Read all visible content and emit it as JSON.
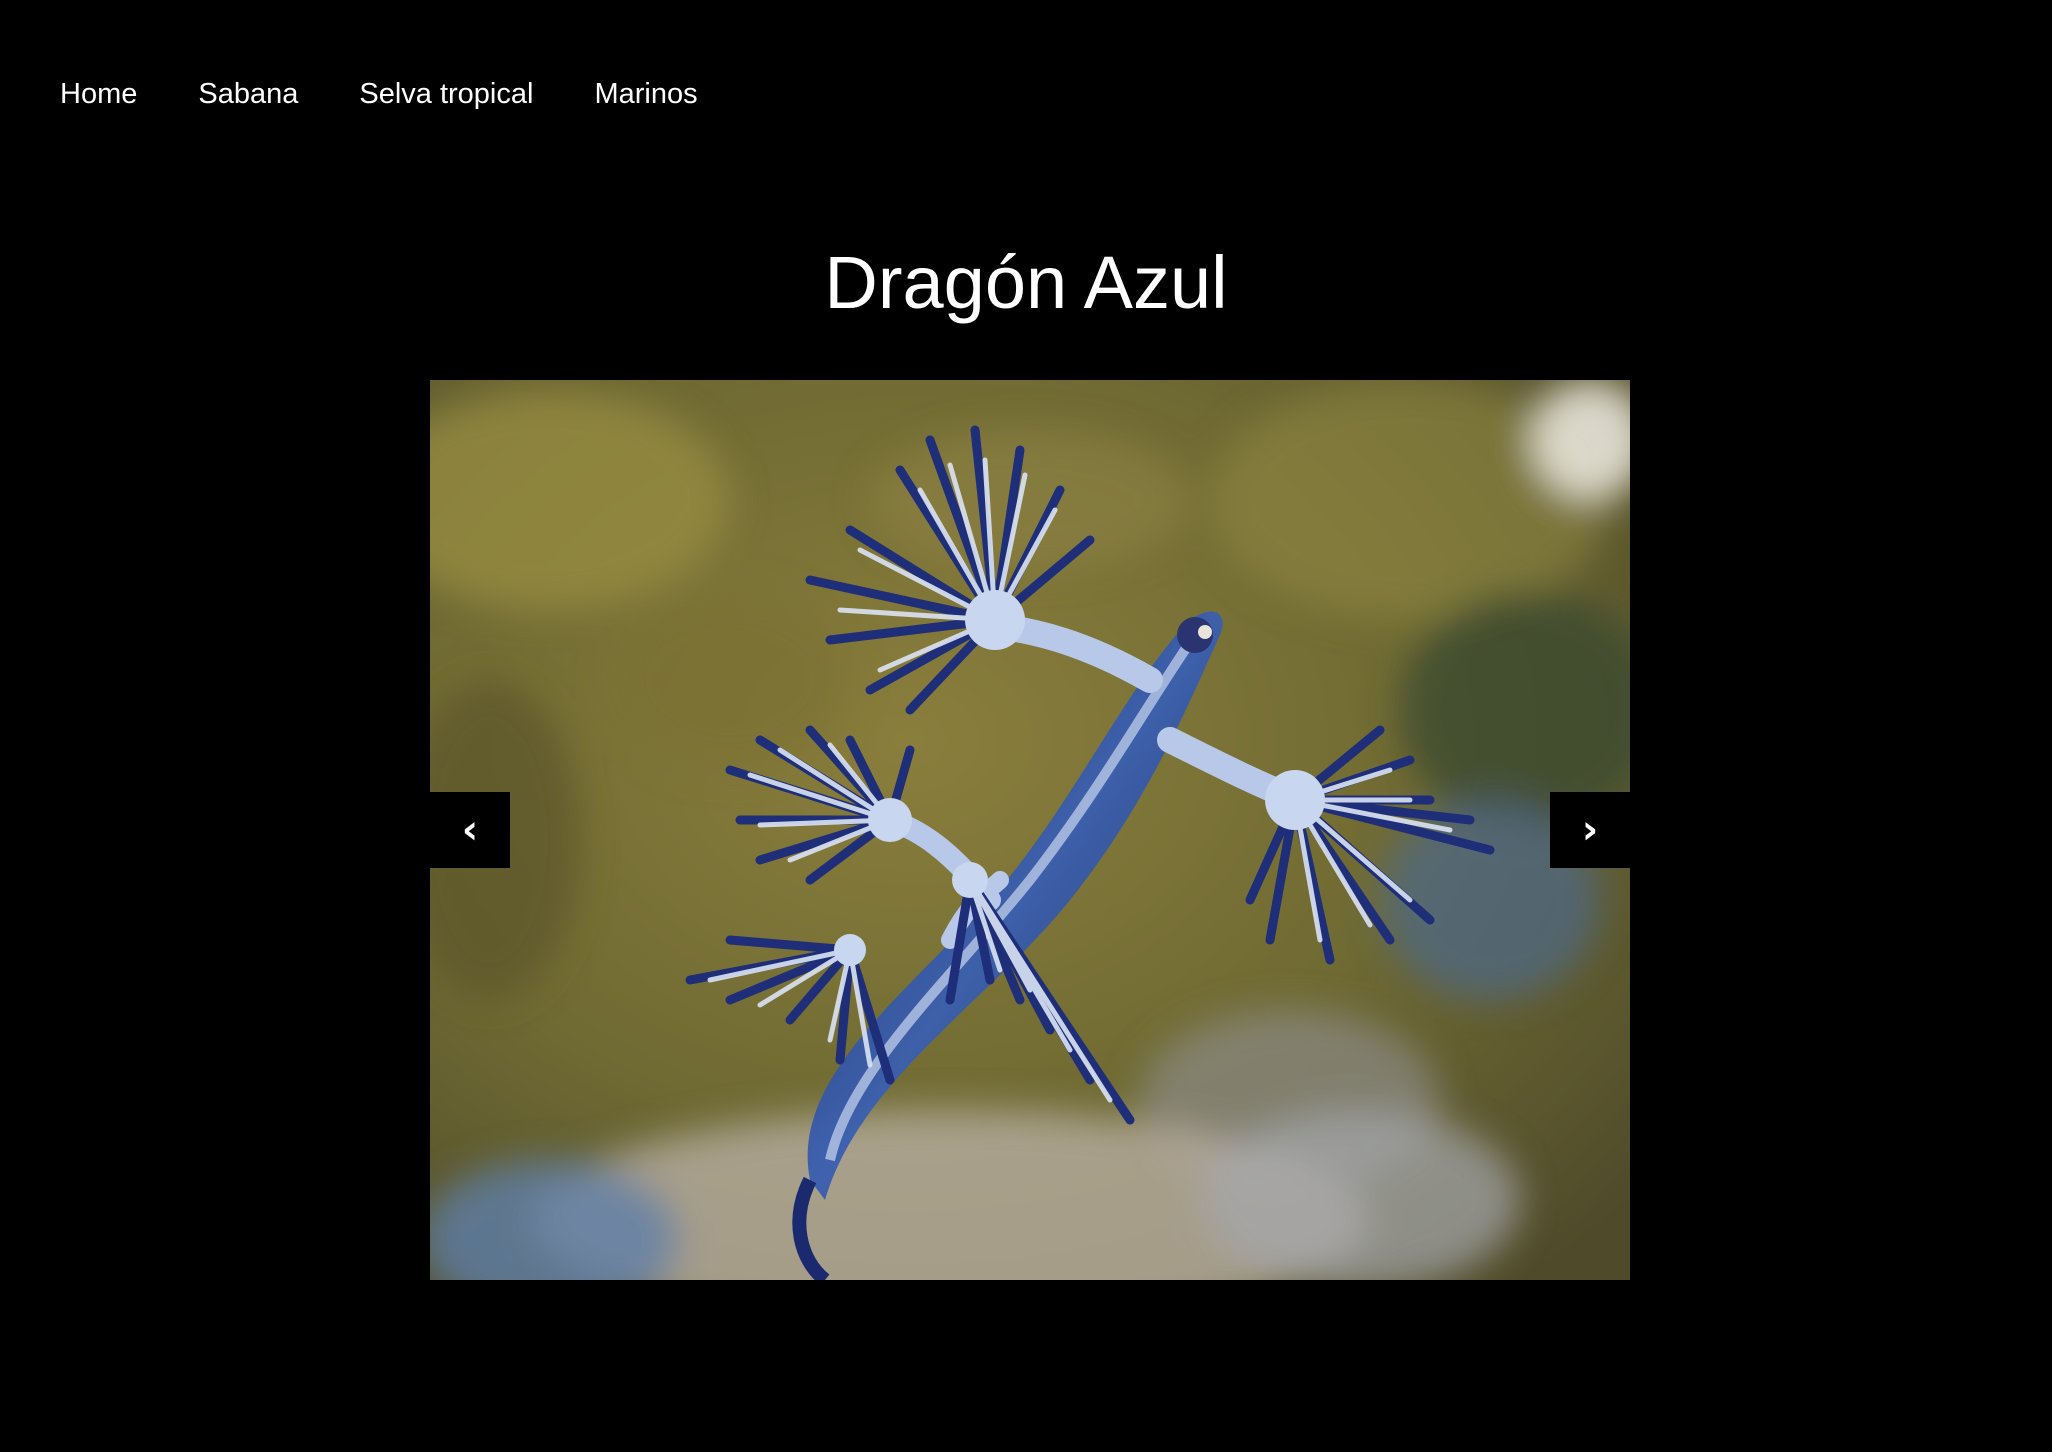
{
  "nav": {
    "items": [
      {
        "label": "Home"
      },
      {
        "label": "Sabana"
      },
      {
        "label": "Selva tropical"
      },
      {
        "label": "Marinos"
      }
    ]
  },
  "page": {
    "title": "Dragón Azul"
  },
  "carousel": {
    "prev_label": "‹",
    "next_label": "›",
    "image_subject": "blue-dragon-sea-slug"
  },
  "colors": {
    "background": "#000000",
    "text": "#ffffff",
    "slug_blue": "#2a3f8f",
    "slug_light": "#c9d6ef",
    "sand_olive": "#7d7434"
  }
}
